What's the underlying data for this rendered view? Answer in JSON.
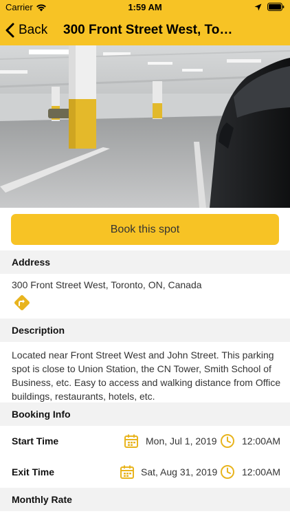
{
  "status_bar": {
    "carrier": "Carrier",
    "time": "1:59 AM",
    "icons": [
      "wifi-icon",
      "location-arrow-icon",
      "battery-icon"
    ]
  },
  "nav": {
    "back_label": "Back",
    "title": "300 Front Street West, Toro..."
  },
  "photo": {
    "subject": "underground parking garage with yellow-striped pillars and a dark car"
  },
  "book_button": {
    "label": "Book this spot"
  },
  "address": {
    "header": "Address",
    "value": "300 Front Street West, Toronto, ON, Canada",
    "directions_icon": "directions-icon"
  },
  "description": {
    "header": "Description",
    "text": "Located near Front Street West and John Street. This parking spot is close to Union Station, the CN Tower, Smith School of Business, etc. Easy to access and walking distance from Office buildings, restaurants, hotels, etc."
  },
  "booking_info": {
    "header": "Booking Info",
    "start": {
      "label": "Start Time",
      "date": "Mon, Jul 1, 2019",
      "time": "12:00AM"
    },
    "exit": {
      "label": "Exit Time",
      "date": "Sat, Aug 31, 2019",
      "time": "12:00AM"
    }
  },
  "monthly_rate": {
    "header": "Monthly Rate"
  },
  "colors": {
    "accent": "#f7c325",
    "section_bg": "#f2f2f2",
    "icon": "#e8b41e",
    "text": "#333333"
  }
}
